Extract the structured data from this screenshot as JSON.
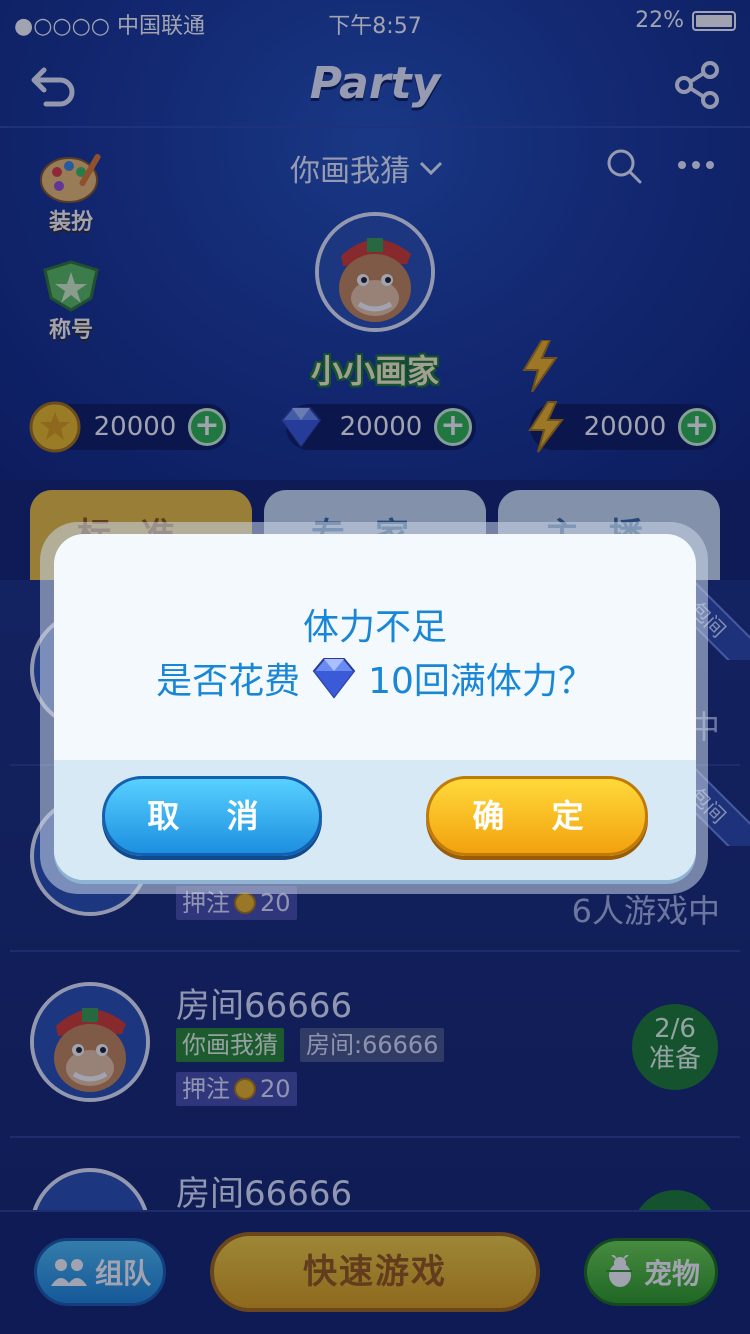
{
  "status_bar": {
    "carrier": "●○○○○ 中国联通",
    "time": "下午8:57",
    "battery": "22%"
  },
  "header": {
    "title": "Party",
    "game_selector": "你画我猜"
  },
  "side_buttons": {
    "dress_up": "装扮",
    "titles": "称号"
  },
  "profile": {
    "nickname": "小小画家"
  },
  "resources": {
    "coins": "20000",
    "gems": "20000",
    "energy": "20000"
  },
  "tabs": [
    {
      "label": "标准",
      "active": true
    },
    {
      "label": "专家",
      "active": false
    },
    {
      "label": "主播",
      "active": false
    }
  ],
  "rooms": [
    {
      "name": "",
      "game_tag": "",
      "room_tag": "",
      "bet": "押注",
      "bet_amount": "20",
      "players": "6人游戏中",
      "status": "",
      "ribbon": "包间"
    },
    {
      "name": "房间66666",
      "game_tag": "你画我猜",
      "room_tag": "房间:66666",
      "bet": "押注",
      "bet_amount": "20",
      "status_count": "2/6",
      "status_text": "准备"
    },
    {
      "name": "房间66666"
    }
  ],
  "partial_texts": {
    "first_players_tail": "中",
    "ribbon_2": "包间"
  },
  "bottom_bar": {
    "team": "组队",
    "quick_play": "快速游戏",
    "pet": "宠物"
  },
  "dialog": {
    "line1": "体力不足",
    "line2_prefix": "是否花费",
    "line2_suffix": "10回满体力？",
    "cancel": "取 消",
    "confirm": "确 定"
  },
  "colors": {
    "accent_blue": "#1a86d6",
    "confirm_yellow": "#f2a20e",
    "cancel_blue": "#1d8fe0",
    "ready_green": "#1d7d2c"
  }
}
